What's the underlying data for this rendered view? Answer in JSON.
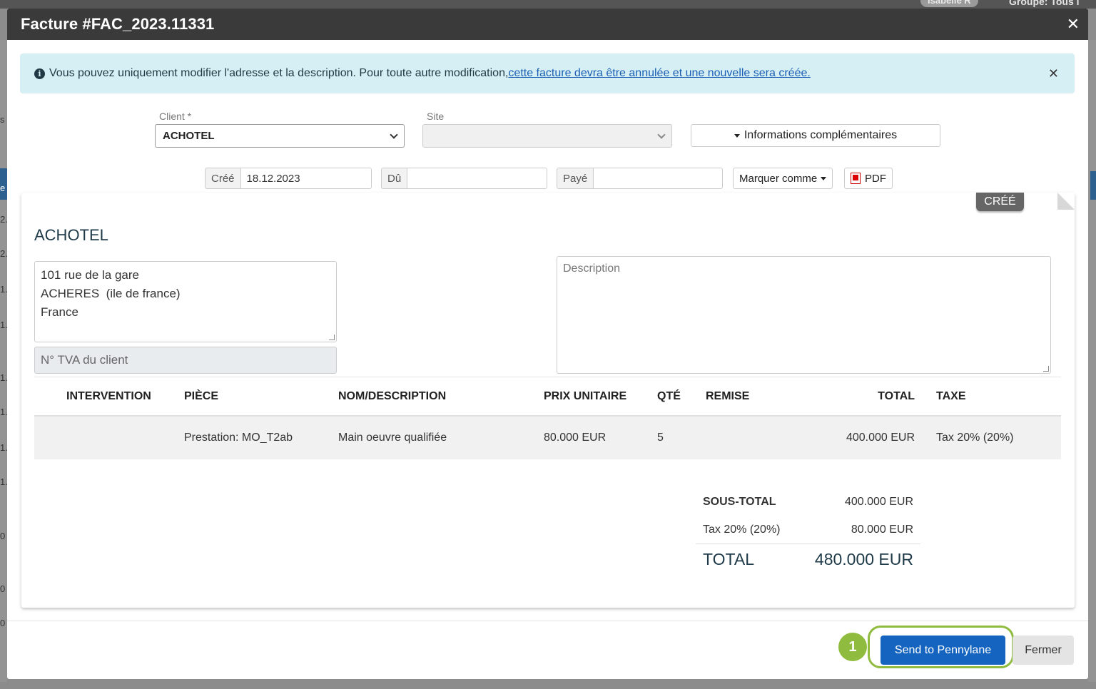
{
  "background": {
    "user_label": "Isabelle R",
    "groupe_label": "Groupe: Tous l",
    "left_rows": [
      "s",
      "e",
      "2.",
      "2.",
      "1.",
      "1.",
      "1.",
      "1.",
      "1.",
      "1.",
      "0",
      "0",
      "0"
    ]
  },
  "modal": {
    "title": "Facture #FAC_2023.11331",
    "close_glyph": "✕"
  },
  "alert": {
    "icon_glyph": "i",
    "text": "Vous pouvez uniquement modifier l'adresse et la description. Pour toute autre modification,",
    "link_text": "cette facture devra être annulée et une nouvelle sera créée.",
    "close_glyph": "✕"
  },
  "fields": {
    "client_label": "Client *",
    "client_value": "ACHOTEL",
    "site_label": "Site",
    "site_value": "",
    "info_button": "Informations complémentaires"
  },
  "dates": {
    "created_label": "Créé",
    "created_value": "18.12.2023",
    "due_label": "Dû",
    "due_value": "",
    "paid_label": "Payé",
    "paid_value": "",
    "mark_as_button": "Marquer comme",
    "pdf_button": "PDF"
  },
  "invoice": {
    "status": "CRÉÉ",
    "client_name": "ACHOTEL",
    "address_lines": [
      "101 rue de la gare",
      "ACHERES  (ile de france)",
      "France"
    ],
    "tva_placeholder": "N° TVA du client",
    "description_placeholder": "Description",
    "columns": {
      "intervention": "INTERVENTION",
      "piece": "PIÈCE",
      "description": "NOM/DESCRIPTION",
      "unit_price": "PRIX UNITAIRE",
      "qty": "QTÉ",
      "discount": "REMISE",
      "total": "TOTAL",
      "tax": "TAXE"
    },
    "rows": [
      {
        "intervention": "",
        "piece": "Prestation: MO_T2ab",
        "description": "Main oeuvre qualifiée",
        "unit_price": "80.000 EUR",
        "qty": "5",
        "discount": "",
        "total": "400.000 EUR",
        "tax": "Tax 20% (20%)"
      }
    ],
    "totals": {
      "subtotal_label": "SOUS-TOTAL",
      "subtotal_value": "400.000 EUR",
      "tax_label": "Tax 20% (20%)",
      "tax_value": "80.000 EUR",
      "total_label": "TOTAL",
      "total_value": "480.000 EUR"
    }
  },
  "footer": {
    "step_number": "1",
    "send_button": "Send to Pennylane",
    "close_button": "Fermer"
  },
  "colors": {
    "primary": "#1565c0",
    "highlight": "#8fbc3f",
    "alert_bg": "#d6eff4",
    "header_bg": "#3a3a3a"
  }
}
